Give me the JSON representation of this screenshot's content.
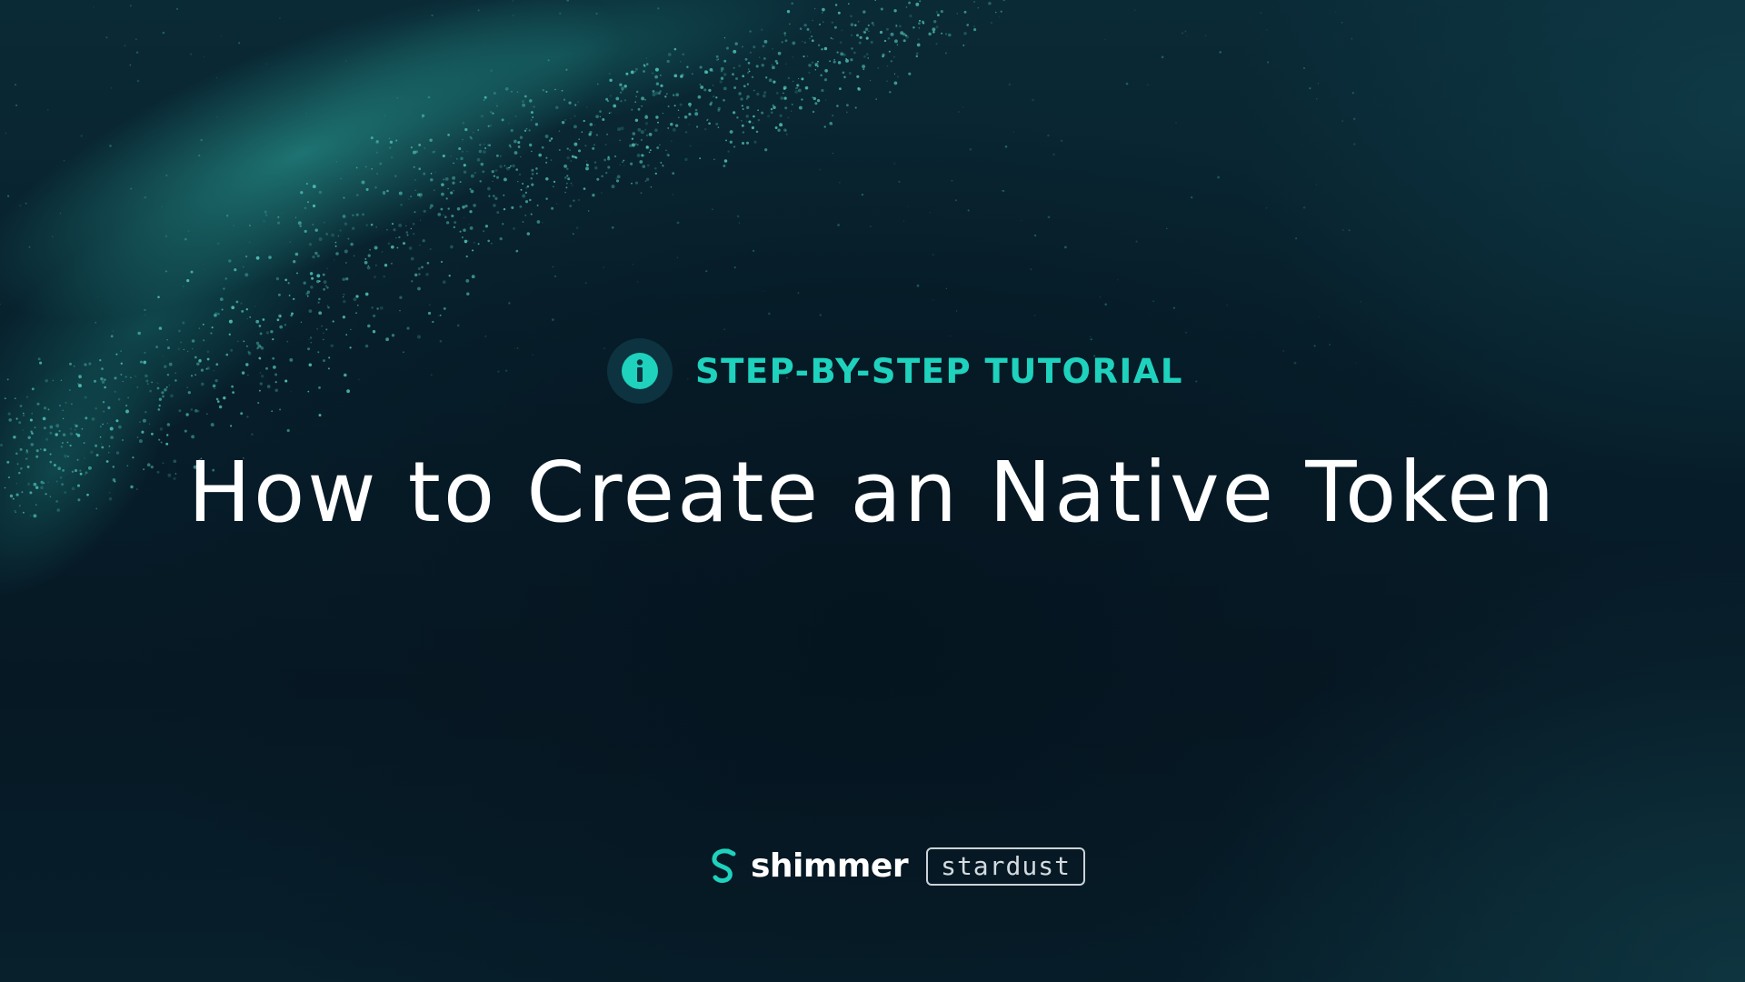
{
  "hero": {
    "kicker": "STEP-BY-STEP TUTORIAL",
    "title": "How to Create an Native Token",
    "badge_icon": "info-icon"
  },
  "footer": {
    "logo_icon": "shimmer-logo-icon",
    "brand_name": "shimmer",
    "edition": "stardust"
  },
  "colors": {
    "accent": "#1ed2bd",
    "background": "#061a26",
    "title": "#ffffff"
  }
}
